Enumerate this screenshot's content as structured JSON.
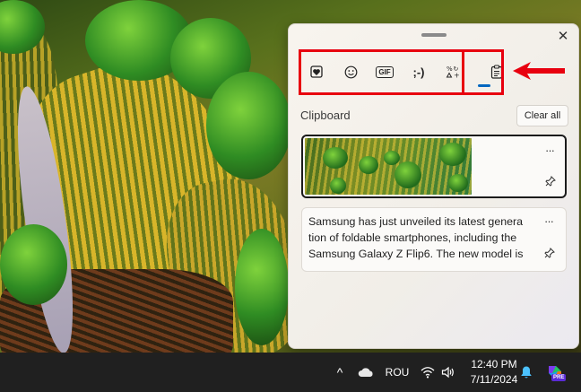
{
  "panel": {
    "tabs": [
      {
        "name": "stickers",
        "icon": "heart-sticker-icon"
      },
      {
        "name": "emoji",
        "icon": "smiley-icon"
      },
      {
        "name": "gif",
        "label": "GIF",
        "icon": "gif-icon"
      },
      {
        "name": "kaomoji",
        "label": ";-)",
        "icon": "kaomoji-icon"
      },
      {
        "name": "symbols",
        "icon": "symbols-icon"
      },
      {
        "name": "clipboard",
        "icon": "clipboard-icon",
        "active": true
      }
    ],
    "close_label": "✕",
    "section_title": "Clipboard",
    "clear_all_label": "Clear all",
    "items": [
      {
        "type": "image",
        "description_icon": "aerial-field-thumbnail"
      },
      {
        "type": "text",
        "lines": [
          "Samsung has just unveiled its latest genera",
          "tion of foldable smartphones, including the",
          "Samsung Galaxy Z Flip6. The new model is"
        ]
      }
    ],
    "more_label": "···",
    "pin_label": "📌"
  },
  "annotation": {
    "color": "#e8000f"
  },
  "taskbar": {
    "chevron": "^",
    "language": "ROU",
    "time": "12:40 PM",
    "date": "7/11/2024",
    "copilot_badge": "PRE"
  },
  "colors": {
    "accent": "#0067c0",
    "highlight": "#e8000f",
    "taskbar": "#202020"
  }
}
